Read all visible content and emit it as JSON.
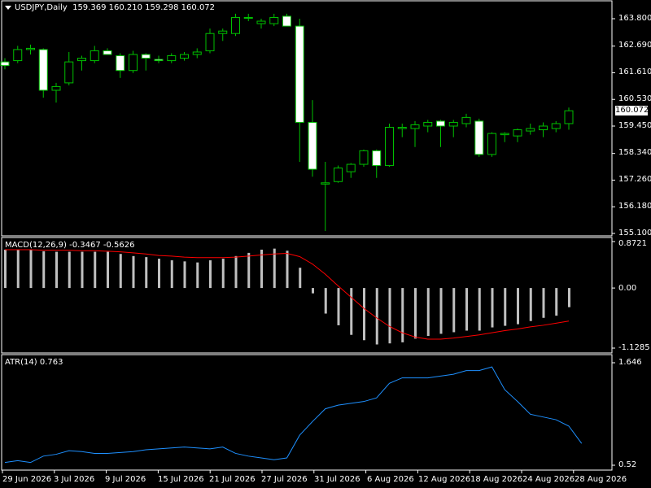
{
  "header": {
    "symbol": "USDJPY,Daily",
    "ohlc": "159.369 160.210 159.298 160.072"
  },
  "main": {
    "y_labels": [
      "163.800",
      "162.690",
      "161.610",
      "160.530",
      "159.450",
      "158.340",
      "157.260",
      "156.180",
      "155.100"
    ],
    "y_min": 155.1,
    "y_max": 163.8,
    "last_price": "160.072",
    "candles": [
      {
        "o": 162.05,
        "h": 162.2,
        "l": 161.75,
        "c": 161.9
      },
      {
        "o": 162.1,
        "h": 162.7,
        "l": 162.0,
        "c": 162.55
      },
      {
        "o": 162.55,
        "h": 162.75,
        "l": 162.35,
        "c": 162.6
      },
      {
        "o": 162.55,
        "h": 162.6,
        "l": 160.6,
        "c": 160.9
      },
      {
        "o": 160.9,
        "h": 161.2,
        "l": 160.4,
        "c": 161.05
      },
      {
        "o": 161.2,
        "h": 162.45,
        "l": 161.1,
        "c": 162.05
      },
      {
        "o": 162.1,
        "h": 162.3,
        "l": 161.7,
        "c": 162.2
      },
      {
        "o": 162.1,
        "h": 162.7,
        "l": 162.0,
        "c": 162.5
      },
      {
        "o": 162.5,
        "h": 162.6,
        "l": 162.4,
        "c": 162.35
      },
      {
        "o": 162.3,
        "h": 162.4,
        "l": 161.4,
        "c": 161.7
      },
      {
        "o": 161.7,
        "h": 162.5,
        "l": 161.6,
        "c": 162.35
      },
      {
        "o": 162.35,
        "h": 162.4,
        "l": 161.7,
        "c": 162.2
      },
      {
        "o": 162.15,
        "h": 162.3,
        "l": 162.0,
        "c": 162.1
      },
      {
        "o": 162.1,
        "h": 162.4,
        "l": 162.0,
        "c": 162.3
      },
      {
        "o": 162.2,
        "h": 162.45,
        "l": 162.1,
        "c": 162.35
      },
      {
        "o": 162.35,
        "h": 162.6,
        "l": 162.2,
        "c": 162.45
      },
      {
        "o": 162.5,
        "h": 163.4,
        "l": 162.4,
        "c": 163.2
      },
      {
        "o": 163.2,
        "h": 163.4,
        "l": 162.9,
        "c": 163.3
      },
      {
        "o": 163.2,
        "h": 164.0,
        "l": 163.1,
        "c": 163.85
      },
      {
        "o": 163.85,
        "h": 164.0,
        "l": 163.7,
        "c": 163.85
      },
      {
        "o": 163.6,
        "h": 163.8,
        "l": 163.4,
        "c": 163.7
      },
      {
        "o": 163.6,
        "h": 164.0,
        "l": 163.5,
        "c": 163.85
      },
      {
        "o": 163.9,
        "h": 164.0,
        "l": 163.5,
        "c": 163.5
      },
      {
        "o": 163.5,
        "h": 163.8,
        "l": 158.0,
        "c": 159.6
      },
      {
        "o": 159.6,
        "h": 160.5,
        "l": 157.4,
        "c": 157.7
      },
      {
        "o": 157.1,
        "h": 158.0,
        "l": 155.2,
        "c": 157.15
      },
      {
        "o": 157.2,
        "h": 157.85,
        "l": 157.15,
        "c": 157.75
      },
      {
        "o": 157.6,
        "h": 157.95,
        "l": 157.35,
        "c": 157.9
      },
      {
        "o": 157.9,
        "h": 158.5,
        "l": 157.8,
        "c": 158.45
      },
      {
        "o": 158.45,
        "h": 158.5,
        "l": 157.35,
        "c": 157.85
      },
      {
        "o": 157.85,
        "h": 159.55,
        "l": 157.8,
        "c": 159.4
      },
      {
        "o": 159.35,
        "h": 159.55,
        "l": 159.0,
        "c": 159.4
      },
      {
        "o": 159.35,
        "h": 159.65,
        "l": 158.6,
        "c": 159.5
      },
      {
        "o": 159.45,
        "h": 159.7,
        "l": 159.2,
        "c": 159.6
      },
      {
        "o": 159.65,
        "h": 159.7,
        "l": 158.6,
        "c": 159.45
      },
      {
        "o": 159.45,
        "h": 159.7,
        "l": 159.0,
        "c": 159.6
      },
      {
        "o": 159.55,
        "h": 159.95,
        "l": 159.4,
        "c": 159.8
      },
      {
        "o": 159.65,
        "h": 159.75,
        "l": 158.2,
        "c": 158.3
      },
      {
        "o": 158.3,
        "h": 159.2,
        "l": 158.2,
        "c": 159.15
      },
      {
        "o": 159.1,
        "h": 159.2,
        "l": 158.8,
        "c": 159.15
      },
      {
        "o": 159.05,
        "h": 159.35,
        "l": 158.8,
        "c": 159.3
      },
      {
        "o": 159.25,
        "h": 159.55,
        "l": 159.1,
        "c": 159.35
      },
      {
        "o": 159.3,
        "h": 159.6,
        "l": 159.0,
        "c": 159.45
      },
      {
        "o": 159.35,
        "h": 159.65,
        "l": 159.2,
        "c": 159.55
      },
      {
        "o": 159.55,
        "h": 160.2,
        "l": 159.3,
        "c": 160.07
      }
    ]
  },
  "macd": {
    "title": "MACD(12,26,9) -0.3467 -0.5626",
    "y_labels": [
      "0.8721",
      "0.00",
      "-1.1285"
    ],
    "y_min": -1.1285,
    "y_max": 0.8721,
    "bars": [
      0.72,
      0.72,
      0.72,
      0.69,
      0.68,
      0.68,
      0.68,
      0.68,
      0.68,
      0.64,
      0.6,
      0.58,
      0.55,
      0.52,
      0.5,
      0.48,
      0.52,
      0.55,
      0.6,
      0.66,
      0.72,
      0.74,
      0.7,
      0.38,
      -0.1,
      -0.48,
      -0.7,
      -0.88,
      -0.98,
      -1.06,
      -1.04,
      -1.02,
      -0.95,
      -0.9,
      -0.86,
      -0.83,
      -0.8,
      -0.8,
      -0.74,
      -0.71,
      -0.68,
      -0.62,
      -0.56,
      -0.52,
      -0.36
    ],
    "signal": [
      0.72,
      0.72,
      0.72,
      0.71,
      0.71,
      0.71,
      0.7,
      0.7,
      0.69,
      0.68,
      0.66,
      0.64,
      0.61,
      0.6,
      0.58,
      0.57,
      0.57,
      0.57,
      0.58,
      0.6,
      0.62,
      0.64,
      0.65,
      0.59,
      0.45,
      0.26,
      0.04,
      -0.17,
      -0.38,
      -0.56,
      -0.72,
      -0.84,
      -0.92,
      -0.96,
      -0.96,
      -0.94,
      -0.91,
      -0.88,
      -0.84,
      -0.8,
      -0.77,
      -0.73,
      -0.7,
      -0.66,
      -0.62
    ]
  },
  "atr": {
    "title": "ATR(14) 0.763",
    "y_labels": [
      "1.646",
      "0.52"
    ],
    "y_min": 0.52,
    "y_max": 1.646,
    "values": [
      0.55,
      0.57,
      0.55,
      0.62,
      0.64,
      0.68,
      0.67,
      0.65,
      0.65,
      0.66,
      0.67,
      0.69,
      0.7,
      0.71,
      0.72,
      0.71,
      0.7,
      0.72,
      0.65,
      0.62,
      0.6,
      0.58,
      0.6,
      0.85,
      1.0,
      1.14,
      1.18,
      1.2,
      1.22,
      1.26,
      1.42,
      1.48,
      1.48,
      1.48,
      1.5,
      1.52,
      1.56,
      1.56,
      1.6,
      1.35,
      1.22,
      1.08,
      1.05,
      1.02,
      0.95,
      0.76
    ]
  },
  "x_labels": [
    "29 Jun 2026",
    "3 Jul 2026",
    "9 Jul 2026",
    "15 Jul 2026",
    "21 Jul 2026",
    "27 Jul 2026",
    "31 Jul 2026",
    "6 Aug 2026",
    "12 Aug 2026",
    "18 Aug 2026",
    "24 Aug 2026",
    "28 Aug 2026"
  ],
  "colors": {
    "background": "#000000",
    "bull": "#00c000",
    "bear_fill": "#ffffff",
    "macd_bars": "#c0c0c0",
    "macd_signal": "#ff0000",
    "atr_line": "#1e90ff",
    "frame": "#ffffff"
  }
}
